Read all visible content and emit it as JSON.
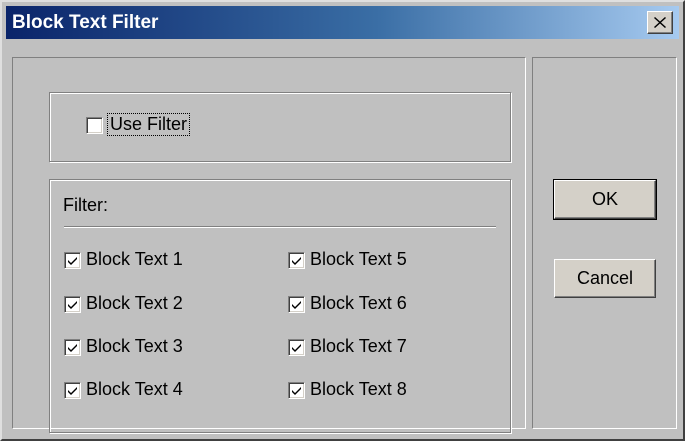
{
  "window": {
    "title": "Block Text Filter"
  },
  "use_filter": {
    "label": "Use Filter",
    "checked": false
  },
  "filter_group": {
    "label": "Filter:",
    "checkboxes": [
      {
        "label": "Block Text 1",
        "checked": true
      },
      {
        "label": "Block Text 2",
        "checked": true
      },
      {
        "label": "Block Text 3",
        "checked": true
      },
      {
        "label": "Block Text 4",
        "checked": true
      },
      {
        "label": "Block Text 5",
        "checked": true
      },
      {
        "label": "Block Text 6",
        "checked": true
      },
      {
        "label": "Block Text 7",
        "checked": true
      },
      {
        "label": "Block Text 8",
        "checked": true
      }
    ]
  },
  "buttons": {
    "ok_label": "OK",
    "cancel_label": "Cancel"
  },
  "colors": {
    "title_gradient_start": "#0a246a",
    "title_gradient_end": "#a6caf0",
    "face": "#c0c0c0"
  },
  "icons": {
    "close": "close-icon",
    "check": "checkmark-icon"
  }
}
